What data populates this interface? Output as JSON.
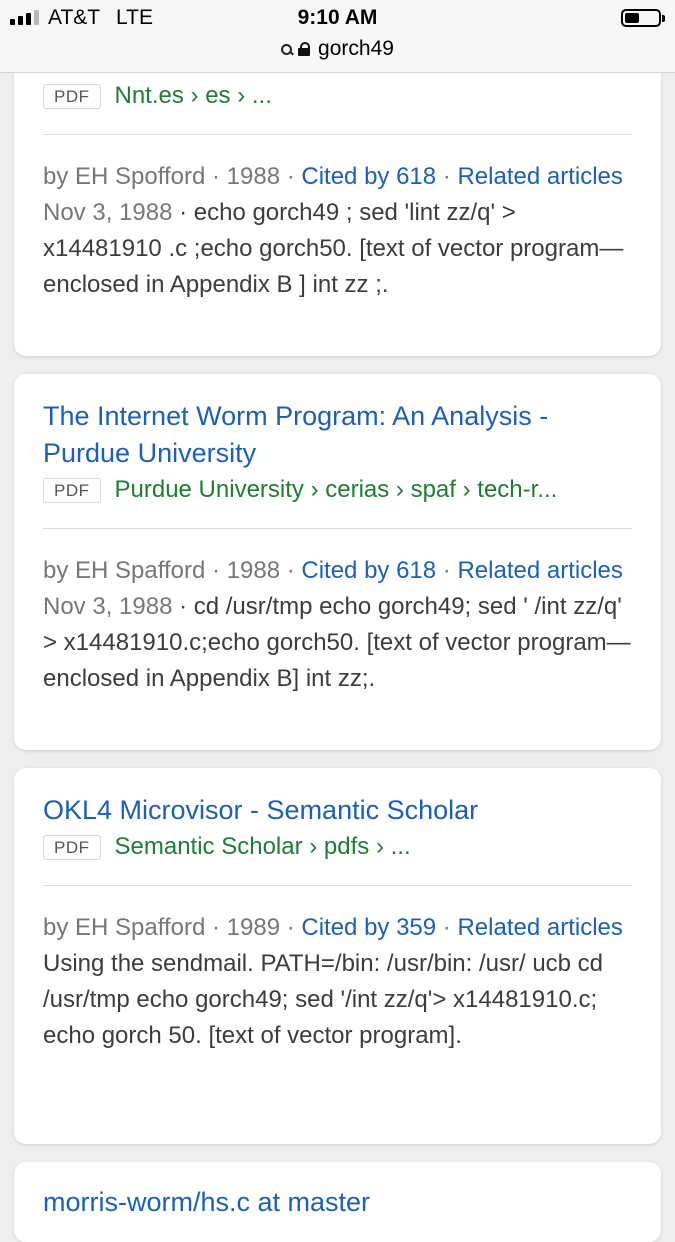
{
  "status_bar": {
    "carrier": "AT&T",
    "network": "LTE",
    "time": "9:10 AM"
  },
  "url_bar": {
    "url": "gorch49"
  },
  "results": [
    {
      "title": "",
      "pdf_badge": "PDF",
      "breadcrumb": "Nnt.es › es › ...",
      "author": "by EH Spofford",
      "year": "1988",
      "cited": "Cited by 618",
      "related": "Related articles",
      "date": "Nov 3, 1988",
      "snippet": "echo gorch49 ; sed 'lint zz/q' > x14481910 .c ;echo gorch50. [text of vector program—enclosed in Appendix B ] int zz ;."
    },
    {
      "title": "The Internet Worm Program: An Analysis - Purdue University",
      "pdf_badge": "PDF",
      "breadcrumb": "Purdue University › cerias › spaf › tech-r...",
      "author": "by EH Spafford",
      "year": "1988",
      "cited": "Cited by 618",
      "related": "Related articles",
      "date": "Nov 3, 1988",
      "snippet": "cd /usr/tmp echo gorch49; sed ' /int zz/q' > x14481910.c;echo gorch50. [text of vector program—enclosed in Appendix B] int zz;."
    },
    {
      "title": "OKL4 Microvisor - Semantic Scholar",
      "pdf_badge": "PDF",
      "breadcrumb": "Semantic Scholar › pdfs › ...",
      "author": "by EH Spafford",
      "year": "1989",
      "cited": "Cited by 359",
      "related": "Related articles",
      "date": "",
      "snippet": "Using the sendmail. PATH=/bin: /usr/bin: /usr/ ucb cd /usr/tmp echo gorch49; sed '/int zz/q'> x14481910.c; echo gorch 50. [text of vector program]."
    }
  ],
  "next_result_title_partial": "morris-worm/hs.c at master",
  "colors": {
    "link": "#1a5fbf",
    "breadcrumb": "#1e7d32",
    "muted": "#777777",
    "text": "#3c3c3c",
    "background": "#eeeeee"
  }
}
